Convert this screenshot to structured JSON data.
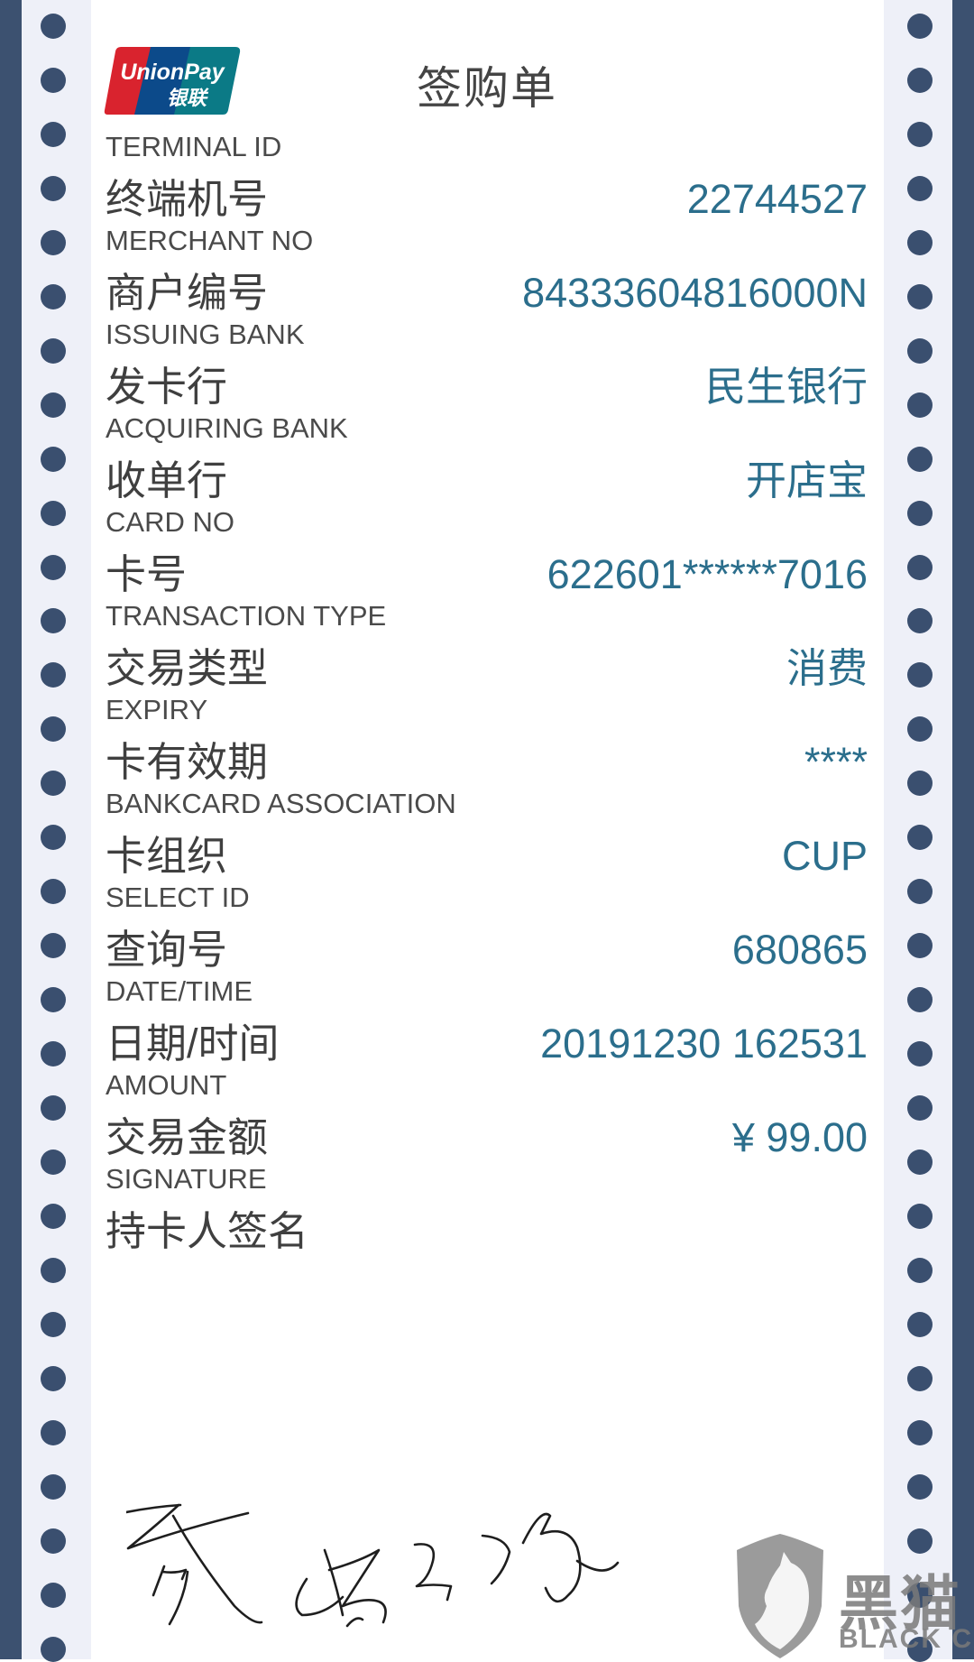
{
  "receipt": {
    "title": "签购单",
    "logo": {
      "name": "unionpay-logo",
      "text_en": "UnionPay",
      "text_zh": "银联"
    },
    "colors": {
      "value": "#2b6e8c",
      "label": "#3f3f3f",
      "strip_dark": "#3c5170",
      "strip_light": "#eef0f8",
      "dot": "#3a4f6f",
      "logo_red": "#d9232e",
      "logo_blue": "#0c4a8a",
      "logo_teal": "#0b7a86"
    },
    "fields": [
      {
        "label_en": "TERMINAL ID",
        "label_zh": "终端机号",
        "value": "22744527"
      },
      {
        "label_en": "MERCHANT NO",
        "label_zh": "商户编号",
        "value": "84333604816000N"
      },
      {
        "label_en": "ISSUING BANK",
        "label_zh": "发卡行",
        "value": "民生银行"
      },
      {
        "label_en": "ACQUIRING BANK",
        "label_zh": "收单行",
        "value": "开店宝"
      },
      {
        "label_en": "CARD NO",
        "label_zh": "卡号",
        "value": "622601******7016"
      },
      {
        "label_en": "TRANSACTION TYPE",
        "label_zh": "交易类型",
        "value": "消费"
      },
      {
        "label_en": "EXPIRY",
        "label_zh": "卡有效期",
        "value": "****"
      },
      {
        "label_en": "BANKCARD ASSOCIATION",
        "label_zh": "卡组织",
        "value": "CUP"
      },
      {
        "label_en": "SELECT ID",
        "label_zh": "查询号",
        "value": "680865"
      },
      {
        "label_en": "DATE/TIME",
        "label_zh": "日期/时间",
        "value": "20191230 162531"
      },
      {
        "label_en": "AMOUNT",
        "label_zh": "交易金额",
        "value": "¥ 99.00"
      },
      {
        "label_en": "SIGNATURE",
        "label_zh": "持卡人签名",
        "value": ""
      }
    ]
  },
  "watermark": {
    "text_zh": "黑猫",
    "text_en": "BLACK CAT",
    "icon": "shield-cat-icon"
  }
}
